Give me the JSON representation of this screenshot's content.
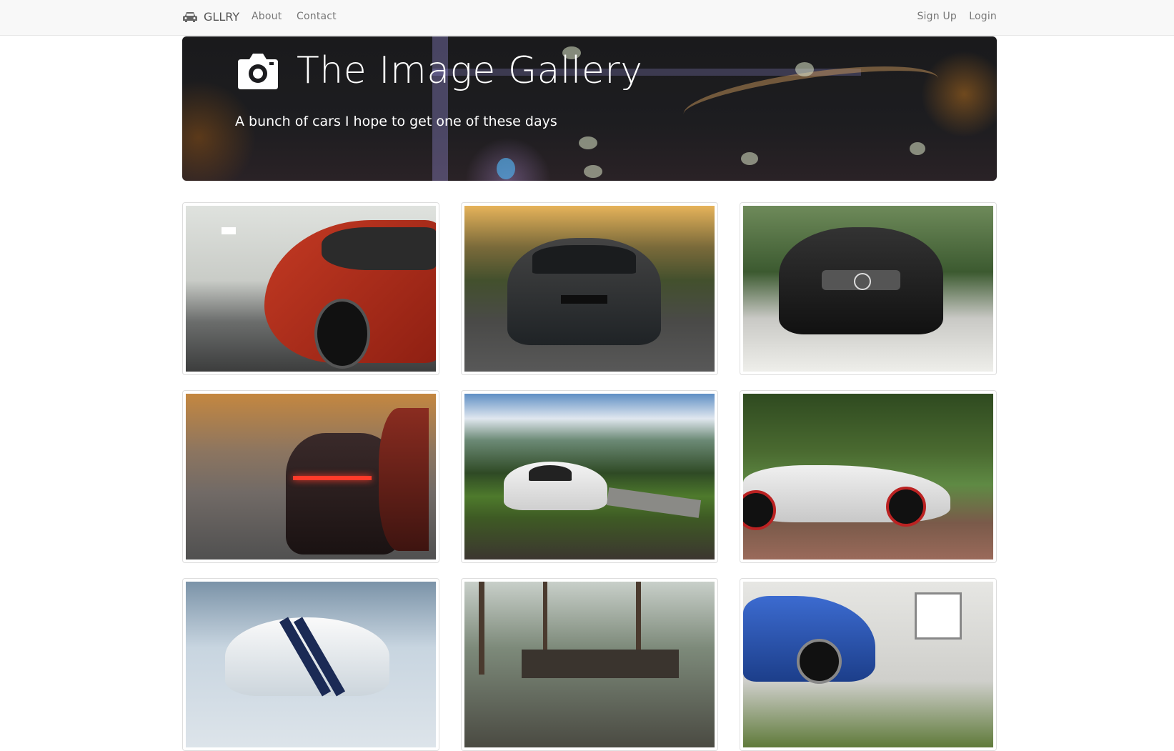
{
  "navbar": {
    "brand": "GLLRY",
    "brand_icon": "car-icon",
    "links": [
      "About",
      "Contact"
    ],
    "right_links": [
      "Sign Up",
      "Login"
    ]
  },
  "hero": {
    "icon": "camera-icon",
    "title": "The Image Gallery",
    "subtitle": "A bunch of cars I hope to get one of these days"
  },
  "gallery": {
    "photos": [
      {
        "subject": "red sports car in garage"
      },
      {
        "subject": "dark grey sedan front view"
      },
      {
        "subject": "black sedan front view"
      },
      {
        "subject": "red car rear lights at sunset street"
      },
      {
        "subject": "white sedan on grass field"
      },
      {
        "subject": "silver convertible in park"
      },
      {
        "subject": "white coupe with blue stripes"
      },
      {
        "subject": "car near trees and house"
      },
      {
        "subject": "blue coupe beside white house"
      }
    ]
  }
}
